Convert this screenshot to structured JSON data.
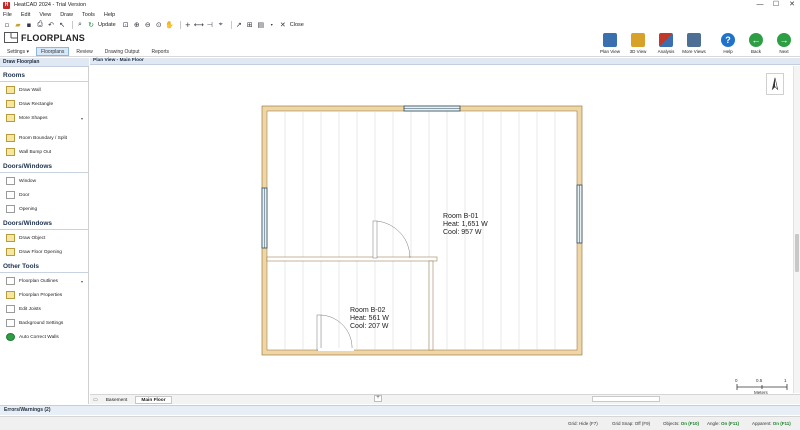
{
  "app": {
    "title": "HeatCAD 2024 - Trial Version",
    "icon_text": "H"
  },
  "window_controls": {
    "minimize": "—",
    "maximize": "☐",
    "close": "✕"
  },
  "menu": [
    "File",
    "Edit",
    "View",
    "Draw",
    "Tools",
    "Help"
  ],
  "quickbar": {
    "update_label": "Update",
    "close_label": "Close"
  },
  "ribbon": {
    "title": "FLOORPLANS",
    "tabs": [
      "Settings",
      "Floorplans",
      "Review",
      "Drawing Output",
      "Reports"
    ],
    "active_tab": "Floorplans",
    "settings_dropdown": "▾",
    "buttons": [
      {
        "label": "Plan View",
        "icon": "plan-view-icon",
        "color": "#3a6fb0"
      },
      {
        "label": "3D View",
        "icon": "3d-view-icon",
        "color": "#d8a12a"
      },
      {
        "label": "Analysis",
        "icon": "analysis-icon",
        "color": "#c0392b"
      },
      {
        "label": "More Views",
        "icon": "more-views-icon",
        "color": "#4d6f96"
      },
      {
        "label": "Help",
        "icon": "help-icon",
        "color": "#1f72c9"
      },
      {
        "label": "Back",
        "icon": "back-icon",
        "color": "#2e9e45"
      },
      {
        "label": "Next",
        "icon": "next-icon",
        "color": "#2e9e45"
      }
    ]
  },
  "left_panel": {
    "header": "Draw Floorplan",
    "sections": [
      {
        "title": "Rooms",
        "items": [
          {
            "label": "Draw Wall",
            "icon": "draw-wall-icon",
            "dropdown": ""
          },
          {
            "label": "Draw Rectangle",
            "icon": "draw-rectangle-icon",
            "dropdown": ""
          },
          {
            "label": "More Shapes",
            "icon": "more-shapes-icon",
            "dropdown": "▾"
          },
          {
            "label": "Room Boundary / Split",
            "icon": "room-boundary-icon",
            "dropdown": ""
          },
          {
            "label": "Wall Bump Out",
            "icon": "wall-bump-out-icon",
            "dropdown": ""
          }
        ]
      },
      {
        "title": "Doors/Windows",
        "items": [
          {
            "label": "Window",
            "icon": "window-icon",
            "dropdown": ""
          },
          {
            "label": "Door",
            "icon": "door-icon",
            "dropdown": ""
          },
          {
            "label": "Opening",
            "icon": "opening-icon",
            "dropdown": ""
          }
        ]
      },
      {
        "title": "Doors/Windows",
        "items": [
          {
            "label": "Draw Object",
            "icon": "draw-object-icon",
            "dropdown": ""
          },
          {
            "label": "Draw Floor Opening",
            "icon": "draw-floor-opening-icon",
            "dropdown": ""
          }
        ]
      },
      {
        "title": "Other Tools",
        "items": [
          {
            "label": "Floorplan Outlines",
            "icon": "floorplan-outlines-icon",
            "dropdown": "▾"
          },
          {
            "label": "Floorplan Properties",
            "icon": "floorplan-properties-icon",
            "dropdown": ""
          },
          {
            "label": "Edit Joists",
            "icon": "edit-joists-icon",
            "dropdown": ""
          },
          {
            "label": "Background Settings",
            "icon": "background-settings-icon",
            "dropdown": ""
          },
          {
            "label": "Auto Correct Walls",
            "icon": "auto-correct-walls-icon",
            "dropdown": ""
          }
        ]
      }
    ]
  },
  "view": {
    "tab_title": "Plan View - Main Floor",
    "rooms": [
      {
        "name": "Room B-01",
        "heat": "Heat: 1,651 W",
        "cool": "Cool: 957 W"
      },
      {
        "name": "Room B-02",
        "heat": "Heat: 561 W",
        "cool": "Cool: 207 W"
      }
    ],
    "scale": {
      "ticks": [
        "0",
        "0.5",
        "1"
      ],
      "unit": "Meters"
    },
    "floor_tabs": [
      "Basement",
      "Main Floor"
    ],
    "active_floor": "Main Floor",
    "add_tab": "+"
  },
  "errors_bar": "Errors/Warnings (2)",
  "statusbar": [
    {
      "label": "Grid: Hide (F7)",
      "state": ""
    },
    {
      "label": "Grid Snap: Off (F9)",
      "state": ""
    },
    {
      "label": "Objects:",
      "state": "On (F10)"
    },
    {
      "label": "Angle:",
      "state": "On (F11)"
    },
    {
      "label": "Apparent:",
      "state": "On (F11)"
    }
  ]
}
